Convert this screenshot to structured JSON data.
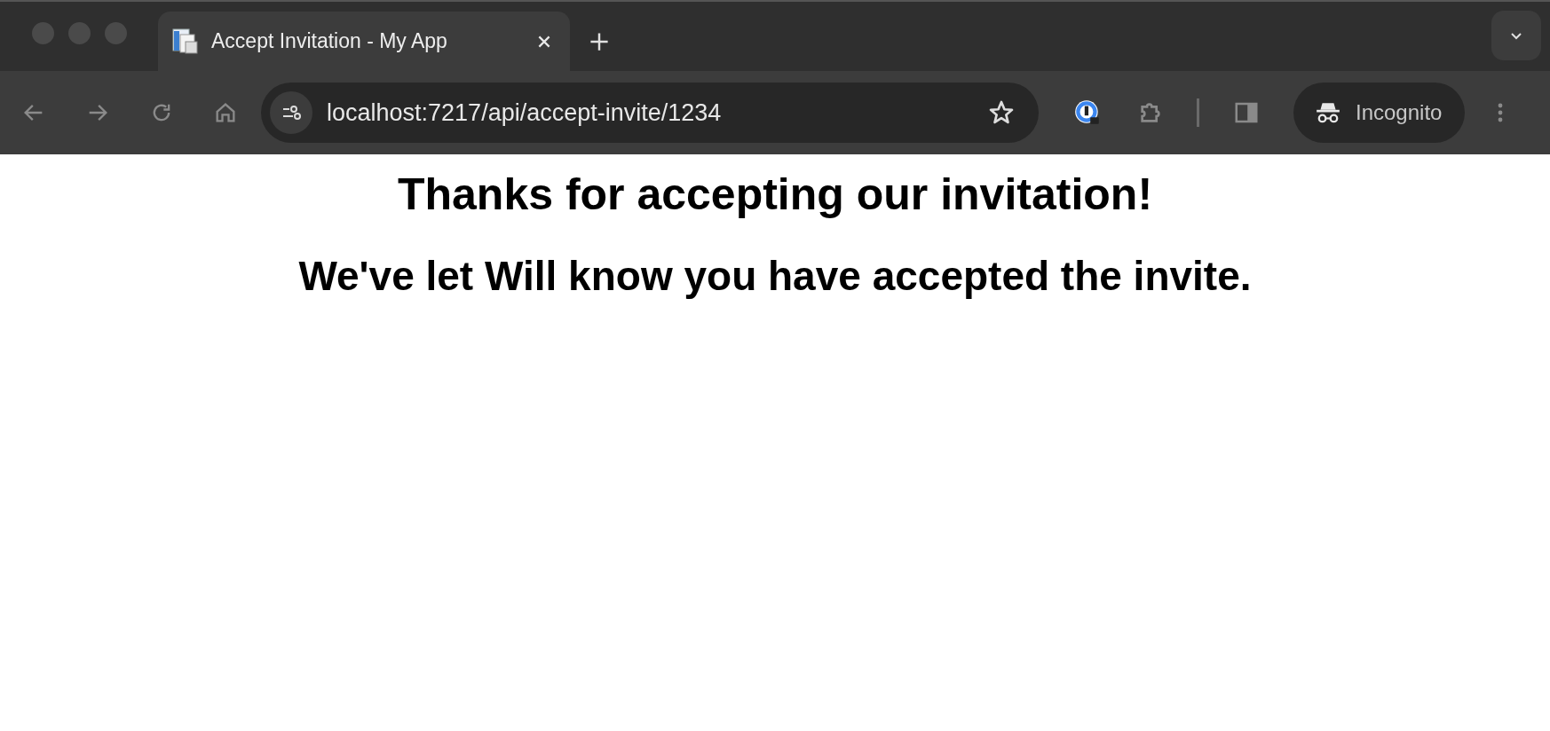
{
  "window": {
    "tab": {
      "title": "Accept Invitation - My App",
      "selected": true
    }
  },
  "toolbar": {
    "url": "localhost:7217/api/accept-invite/1234",
    "profile": "Incognito"
  },
  "page": {
    "heading": "Thanks for accepting our invitation!",
    "subheading": "We've let Will know you have accepted the invite."
  }
}
